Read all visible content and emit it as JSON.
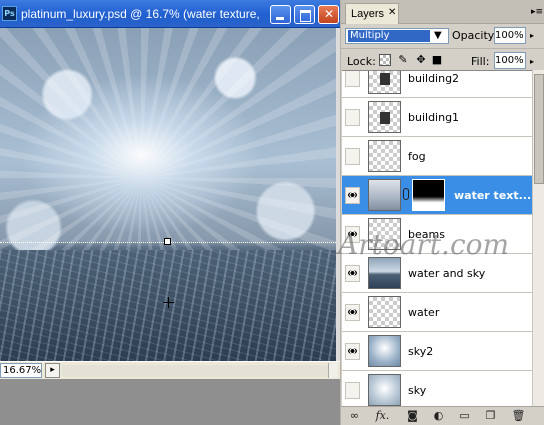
{
  "document": {
    "ps_badge": "Ps",
    "title": "platinum_luxury.psd @ 16.7% (water texture,",
    "zoom": "16.67%",
    "status_menu_glyph": "▸"
  },
  "layers_panel": {
    "tab_label": "Layers",
    "tab_close": "✕",
    "menu_glyph": "▸≡",
    "blend_mode": "Multiply",
    "opacity_label": "Opacity:",
    "opacity_value": "100%",
    "lock_label": "Lock:",
    "fill_label": "Fill:",
    "fill_value": "100%",
    "layers": [
      {
        "name": "building2",
        "visible": false,
        "selected": false
      },
      {
        "name": "building1",
        "visible": false,
        "selected": false
      },
      {
        "name": "fog",
        "visible": false,
        "selected": false
      },
      {
        "name": "water text...",
        "visible": true,
        "selected": true
      },
      {
        "name": "beams",
        "visible": true,
        "selected": false
      },
      {
        "name": "water and sky",
        "visible": true,
        "selected": false
      },
      {
        "name": "water",
        "visible": true,
        "selected": false
      },
      {
        "name": "sky2",
        "visible": true,
        "selected": false
      },
      {
        "name": "sky",
        "visible": false,
        "selected": false
      }
    ],
    "footer_icons": [
      "link-icon",
      "fx-icon",
      "mask-icon",
      "adjustment-icon",
      "group-icon",
      "new-layer-icon",
      "trash-icon"
    ]
  },
  "watermark": "Artoart.com",
  "colors": {
    "title_bar": "#1f5fd0",
    "selected_row": "#3a8ee6",
    "blend_highlight": "#3168c5",
    "panel_bg": "#d4d0c8"
  }
}
